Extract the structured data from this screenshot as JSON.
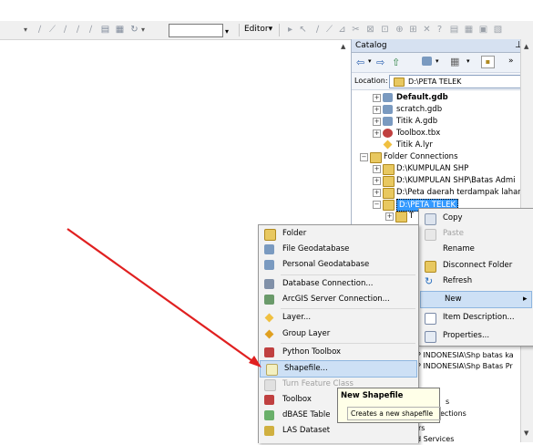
{
  "toolbar": {
    "editor_label": "Editor▾",
    "scale_value": ""
  },
  "catalog": {
    "title": "Catalog",
    "pin": "⊥",
    "close": "×",
    "location_label": "Location:",
    "location_value": "D:\\PETA TELEK",
    "tree": [
      {
        "label": "Default.gdb",
        "icon": "geodatabase-icon",
        "bold": true
      },
      {
        "label": "scratch.gdb",
        "icon": "geodatabase-icon"
      },
      {
        "label": "Titik A.gdb",
        "icon": "geodatabase-icon"
      },
      {
        "label": "Toolbox.tbx",
        "icon": "toolbox-icon"
      },
      {
        "label": "Titik A.lyr",
        "icon": "layer-file-icon"
      },
      {
        "label": "Folder Connections",
        "icon": "folder-connections-icon"
      },
      {
        "label": "D:\\KUMPULAN SHP",
        "icon": "folder-icon"
      },
      {
        "label": "D:\\KUMPULAN SHP\\Batas Admi",
        "icon": "folder-icon"
      },
      {
        "label": "D:\\Peta daerah terdampak lahar",
        "icon": "folder-icon"
      },
      {
        "label": "D:\\PETA TELEK",
        "icon": "folder-icon",
        "selected": true
      },
      {
        "label": "T",
        "icon": "folder-icon"
      }
    ],
    "partial_rows": [
      "P indo latest free",
      "P INDONESIA\\Shp batas ka",
      "P INDONESIA\\Shp Batas Pr",
      "s",
      "ections",
      "rs",
      "d Services"
    ]
  },
  "context_menu": {
    "items": [
      {
        "label": "Copy",
        "icon": "copy-icon"
      },
      {
        "label": "Paste",
        "icon": "paste-icon",
        "disabled": true
      },
      {
        "label": "Rename",
        "icon": ""
      },
      {
        "label": "Disconnect Folder",
        "icon": "disconnect-folder-icon"
      },
      {
        "label": "Refresh",
        "icon": "refresh-icon"
      },
      {
        "label": "New",
        "icon": "",
        "highlighted": true,
        "submenu_arrow": "▸"
      },
      {
        "label": "Item Description...",
        "icon": "item-description-icon"
      },
      {
        "label": "Properties...",
        "icon": "properties-icon"
      }
    ]
  },
  "new_submenu": {
    "items": [
      {
        "label": "Folder",
        "icon": "folder-icon"
      },
      {
        "label": "File Geodatabase",
        "icon": "file-geodatabase-icon"
      },
      {
        "label": "Personal Geodatabase",
        "icon": "personal-geodatabase-icon"
      },
      {
        "label": "Database Connection...",
        "icon": "database-connection-icon"
      },
      {
        "label": "ArcGIS Server Connection...",
        "icon": "server-connection-icon"
      },
      {
        "label": "Layer...",
        "icon": "layer-icon"
      },
      {
        "label": "Group Layer",
        "icon": "group-layer-icon"
      },
      {
        "label": "Python Toolbox",
        "icon": "python-toolbox-icon"
      },
      {
        "label": "Shapefile...",
        "icon": "shapefile-icon",
        "highlighted": true
      },
      {
        "label": "Turn Feature Class",
        "icon": "turn-feature-class-icon",
        "disabled": true
      },
      {
        "label": "Toolbox",
        "icon": "toolbox-icon"
      },
      {
        "label": "dBASE Table",
        "icon": "dbase-table-icon"
      },
      {
        "label": "LAS Dataset",
        "icon": "las-dataset-icon"
      }
    ]
  },
  "tooltip": {
    "title": "New Shapefile",
    "body": "Creates a new shapefile"
  },
  "colors": {
    "highlight_bg": "#cde0f5",
    "highlight_border": "#8eb6e0",
    "arrow": "#e02020",
    "tooltip_bg": "#ffffe8"
  }
}
